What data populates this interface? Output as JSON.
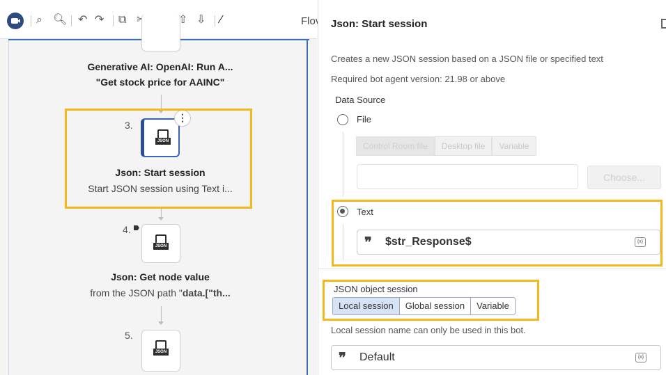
{
  "toolbar": {
    "flow_label": "Flov",
    "icons": [
      "record-icon",
      "find-icon",
      "search-icon",
      "undo-icon",
      "redo-icon",
      "copy-icon",
      "cut-icon",
      "paste-icon",
      "move-up-icon",
      "move-down-icon",
      "disable-icon"
    ]
  },
  "flow": {
    "node_run": {
      "title": "Generative AI: OpenAI: Run A...",
      "subtitle": "\"Get stock price for AAINC\""
    },
    "node3": {
      "number": "3.",
      "title": "Json: Start session",
      "subtitle": "Start JSON session using Text i...",
      "menu_glyph": "⋮"
    },
    "node4": {
      "number": "4.",
      "title": "Json: Get node value",
      "subtitle_prefix": "from the JSON path \"",
      "subtitle_bold": "data.[\"th..."
    },
    "node5": {
      "number": "5."
    },
    "json_tag": "JSON"
  },
  "panel": {
    "title": "Json: Start session",
    "description": "Creates a new JSON session based on a JSON file or specified text",
    "version": "Required bot agent version: 21.98 or above",
    "data_source_label": "Data Source",
    "file_option": "File",
    "file_tabs": [
      "Control Room file",
      "Desktop file",
      "Variable"
    ],
    "choose_button": "Choose...",
    "text_option": "Text",
    "text_value": "$str_Response$",
    "var_icon": "{x}",
    "quote_glyph": "❞",
    "session_label": "JSON object session",
    "session_tabs": [
      "Local session",
      "Global session",
      "Variable"
    ],
    "local_hint": "Local session name can only be used in this bot.",
    "session_value": "Default",
    "selected_source": "Text",
    "selected_session": "Local session"
  }
}
